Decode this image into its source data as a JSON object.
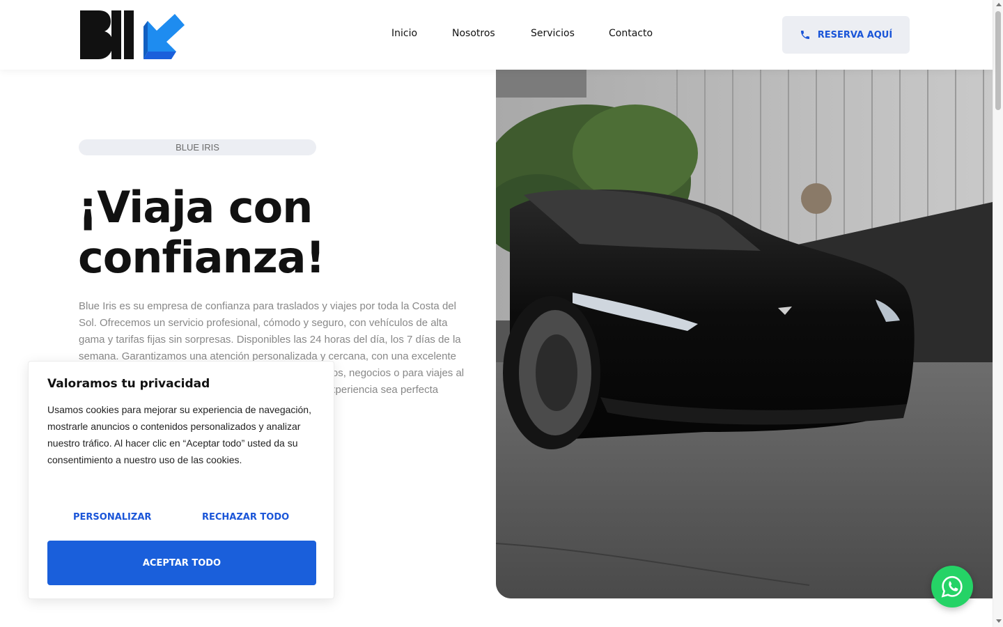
{
  "header": {
    "logo_text": "BII",
    "nav": [
      "Inicio",
      "Nosotros",
      "Servicios",
      "Contacto"
    ],
    "reserve_label": "RESERVA AQUÍ",
    "reserve_icon": "phone-icon"
  },
  "hero": {
    "eyebrow": "BLUE IRIS",
    "title_line1": "¡Viaja con",
    "title_line2": "confianza!",
    "description": "Blue Iris es su empresa de confianza para traslados y viajes por toda la Costa del Sol. Ofrecemos un servicio profesional, cómodo y seguro, con vehículos de alta gama y tarifas fijas sin sorpresas. Disponibles las 24 horas del día, los 7 días de la semana. Garantizamos una atención personalizada y cercana, con una excelente atención al cliente en cada trayecto. Ya sea para eventos, negocios o para viajes al aeropuerto, con Blue Iris nos aseguramos de que su experiencia sea perfecta desde el primer momento."
  },
  "cookie": {
    "title": "Valoramos tu privacidad",
    "text": "Usamos cookies para mejorar su experiencia de navegación, mostrarle anuncios o contenidos personalizados y analizar nuestro tráfico. Al hacer clic en “Aceptar todo” usted da su consentimiento a nuestro uso de las cookies.",
    "personalize_label": "PERSONALIZAR",
    "reject_label": "RECHAZAR TODO",
    "accept_label": "ACEPTAR TODO"
  },
  "floating": {
    "whatsapp_icon": "whatsapp-icon"
  },
  "colors": {
    "accent": "#1a5fdb",
    "whatsapp": "#25d366",
    "pill_bg": "#eceef3"
  }
}
